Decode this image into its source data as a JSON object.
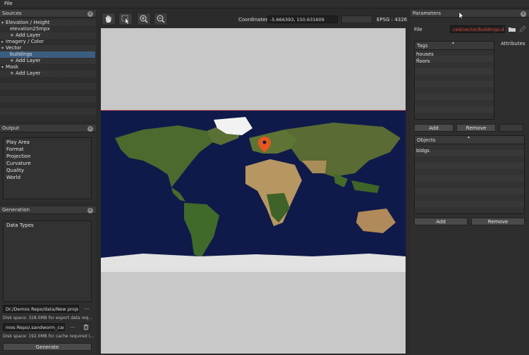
{
  "menu": {
    "file": "File"
  },
  "sources": {
    "title": "Sources",
    "items": [
      {
        "label": "Elevation / Height",
        "kind": "group"
      },
      {
        "label": "elevation25mpx",
        "kind": "layer"
      },
      {
        "label": "+ Add Layer",
        "kind": "add"
      },
      {
        "label": "Imagery / Color",
        "kind": "group-collapsed"
      },
      {
        "label": "Vector",
        "kind": "group"
      },
      {
        "label": "buildings",
        "kind": "layer-selected"
      },
      {
        "label": "+ Add Layer",
        "kind": "add"
      },
      {
        "label": "Mask",
        "kind": "group"
      },
      {
        "label": "+ Add Layer",
        "kind": "add"
      }
    ]
  },
  "output": {
    "title": "Output",
    "items": [
      "Play Area",
      "Format",
      "Projection",
      "Curvature",
      "Quality",
      "World"
    ]
  },
  "generation": {
    "title": "Generation",
    "list_header": "Data Types",
    "export_path": "Dr./Demos Repo/data/New project1",
    "export_browse": "...",
    "export_disk": "Disk space: 328.0MB for export data req...",
    "cache_path": "mos Repo/.sandworm_cache",
    "cache_browse": "...",
    "cache_disk": "Disk space: 192.0MB for cache required (...",
    "generate_label": "Generate"
  },
  "viewer": {
    "coordinates_label": "Coordinates:",
    "coordinates_value": "-5.666393, 150.631609",
    "epsg": "EPSG : 4326",
    "tools": [
      "hand-icon",
      "select-icon",
      "zoom-in-icon",
      "zoom-out-icon"
    ]
  },
  "parameters": {
    "title": "Parameters",
    "file_label": "File",
    "file_value": "ced/vector/buildings.dbf",
    "attributes_label": "Attributes",
    "tags_header": "Tags",
    "tags": [
      "houses",
      "floors"
    ],
    "tags_add": "Add",
    "tags_remove": "Remove",
    "objects_header": "Objects",
    "objects": [
      "bldgs"
    ],
    "objects_add": "Add",
    "objects_remove": "Remove"
  },
  "colors": {
    "file_value_text": "#e0493c",
    "map_ocean": "#0f1a4a",
    "map_pin": "#e8571e",
    "selection": "#3b5e80"
  }
}
